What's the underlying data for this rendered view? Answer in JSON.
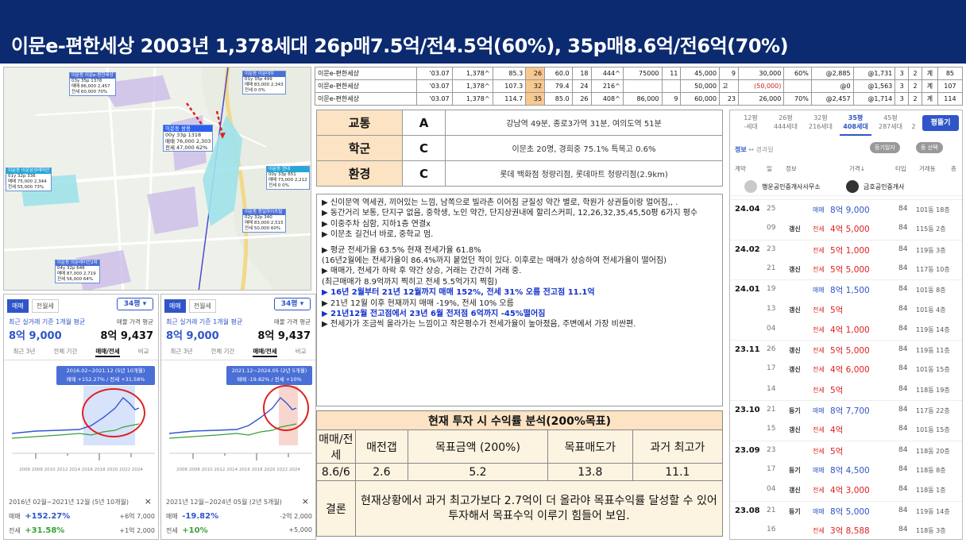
{
  "banner": {
    "title": "이문e-편한세상 2003년 1,378세대 26p매7.5억/전4.5억(60%), 35p매8.6억/전6억(70%)"
  },
  "map": {
    "labels": [
      {
        "title": "이문동 이문e-편한세상",
        "line1": "03y 35p 1378",
        "line2": "매매 86,000 2,457",
        "line3": "전세 60,000 70%"
      },
      {
        "title": "이문동 이문대우",
        "line1": "01y 35p 499",
        "line2": "매매 83,000 2,343",
        "line3": "전세 0 0%"
      },
      {
        "title": "이문동 쌍용",
        "line1": "00y 33p 1318",
        "line2": "매매 76,000 2,303",
        "line3": "전세 47,000 62%"
      },
      {
        "title": "이문동 이문삼성래미안",
        "line1": "01y 32p 336",
        "line2": "매매 75,000 2,344",
        "line3": "전세 55,000 73%"
      },
      {
        "title": "이문동 현대",
        "line1": "00y 33p 651",
        "line2": "매매 73,000 2,212",
        "line3": "전세 0 0%"
      },
      {
        "title": "이문동 동일하이츠빌",
        "line1": "02y 32p 340",
        "line2": "매매 83,000 2,515",
        "line3": "전세 50,000 60%"
      },
      {
        "title": "이문동 이문래미안2차",
        "line1": "04y 32p 646",
        "line2": "매매 87,000 2,719",
        "line3": "전세 56,000 64%"
      }
    ]
  },
  "mini_left": {
    "tab_sale": "매매",
    "tab_jeon": "전월세",
    "size": "34평 ▾",
    "label_avg": "최근 실거래 기준 1개월 평균",
    "label_ask": "매물 가격 평균",
    "value_avg": "8억 9,000",
    "value_ask": "8억 9,437",
    "period_tabs": [
      "최근 3년",
      "전체 기간",
      "매매/전세",
      "비교"
    ],
    "tooltip_line1": "2016.02~2021.12 (5년 10개월)",
    "tooltip_line2": "매매 +152.27% / 전세 +31.58%",
    "years": "2006 2008 2010 2012 2014 2016 2018 2020 2022 2024",
    "range": "2016년 02월~2021년 12월 (5년 10개월)",
    "sale_label": "매매",
    "sale_pct": "+152.27%",
    "sale_amt": "+6억 7,000",
    "jeon_label": "전세",
    "jeon_pct": "+31.58%",
    "jeon_amt": "+1억 2,000",
    "close": "×"
  },
  "mini_right": {
    "tab_sale": "매매",
    "tab_jeon": "전월세",
    "size": "34평 ▾",
    "label_avg": "최근 실거래 기준 1개월 평균",
    "label_ask": "매물 가격 평균",
    "value_avg": "8억 9,000",
    "value_ask": "8억 9,437",
    "period_tabs": [
      "최근 3년",
      "전체 기간",
      "매매/전세",
      "비교"
    ],
    "tooltip_line1": "2021.12~2024.05 (2년 5개월)",
    "tooltip_line2": "매매 -19.82% / 전세 +10%",
    "years": "2006 2008 2010 2012 2014 2016 2018 2020 2022 2024",
    "range": "2021년 12월~2024년 05월 (2년 5개월)",
    "sale_label": "매매",
    "sale_pct": "-19.82%",
    "sale_amt": "-2억 2,000",
    "jeon_label": "전세",
    "jeon_pct": "+10%",
    "jeon_amt": "+5,000",
    "close": "×"
  },
  "data_table": {
    "rows": [
      [
        "이문e-편한세상",
        "'03.07",
        "1,378^",
        "85.3",
        "26",
        "60.0",
        "18",
        "444^",
        "75000",
        "11",
        "45,000",
        "9",
        "30,000",
        "60%",
        "@2,885",
        "@1,731",
        "3",
        "2",
        "계",
        "85"
      ],
      [
        "이문e-편한세상",
        "'03.07",
        "1,378^",
        "107.3",
        "32",
        "79.4",
        "24",
        "216^",
        "",
        "",
        "50,000",
        "고",
        "(50,000)",
        "",
        "@0",
        "@1,563",
        "3",
        "2",
        "계",
        "107"
      ],
      [
        "이문e-편한세상",
        "'03.07",
        "1,378^",
        "114.7",
        "35",
        "85.0",
        "26",
        "408^",
        "86,000",
        "9",
        "60,000",
        "23",
        "26,000",
        "70%",
        "@2,457",
        "@1,714",
        "3",
        "2",
        "계",
        "114"
      ]
    ]
  },
  "rating": {
    "rows": [
      {
        "cat": "교통",
        "grade": "A",
        "desc": "강남역 49분, 종로3가역 31분, 여의도역 51분"
      },
      {
        "cat": "학군",
        "grade": "C",
        "desc": "이문초 20명, 경희중 75.1%  특목고 0.6%"
      },
      {
        "cat": "환경",
        "grade": "C",
        "desc": "롯데 백화점 청량리점, 롯데마트 청량리점(2.9km)"
      }
    ]
  },
  "notes": {
    "lines": [
      "▶ 신이문역 역세권, 끼어있는 느낌, 남쪽으로 빌라촌 이어짐 균질성 약간 별로, 학원가 상권들이랑 멀어짐,, .",
      "▶ 동간거리 보통, 단지구 없음, 중학생, 노인 약간, 단지상권내에 할리스커피, 12,26,32,35,45,50평 6가지 평수",
      "▶ 이중주차 심함, 지하1층 연결x",
      "▶ 이문초 길건너 바로, 중학교 멈.",
      "▶ 평균 전세가율 63.5% 현재 전세가율 61.8%",
      "(16년2월에는 전세가율이 86.4%까지 붙었던 적이 있다. 이후로는 매매가 상승하여 전세가율이 떨어짐)",
      "▶ 매매가, 전세가 하락 후 약간 상승, 거래는 간간히 거래 중.",
      "(최근매매가 8.9억까지 찍히고 전세 5.5억가지 찍힘)",
      "▶ 16년 2월부터 21년 12월까지 매매 152%, 전세 31% 오름 전고점 11.1억",
      "▶ 21년 12월 이후 현재까지 매매 -19%, 전세 10% 오름",
      "▶ 21년12월 전고점에서 23년 6월 전저점 6억까지 -45%떨어짐",
      "▶ 전세가가 조금씩 올라가는 느낌이고 작은평수가 전세가율이 높아졌음, 주변에서 가장 비싼편."
    ]
  },
  "analysis": {
    "title": "현재 투자 시 수익률 분석(200%목표)",
    "headers": [
      "매매/전세",
      "매전갭",
      "목표금액 (200%)",
      "목표매도가",
      "과거 최고가"
    ],
    "values": [
      "8.6/6",
      "2.6",
      "5.2",
      "13.8",
      "11.1"
    ],
    "conclusion_label": "결론",
    "conclusion": "현재상황에서 과거 최고가보다 2.7억이 더 올라야 목표수익률 달성할 수 있어 투자해서 목표수익 이루기 힘들어 보임."
  },
  "rpanel": {
    "size_tabs": [
      {
        "p": "12평",
        "h": "-세대"
      },
      {
        "p": "26평",
        "h": "444세대"
      },
      {
        "p": "32평",
        "h": "216세대"
      },
      {
        "p": "35평",
        "h": "408세대"
      },
      {
        "p": "45평",
        "h": "287세대"
      }
    ],
    "more": "2",
    "pyeong_button": "평뜰기",
    "info_tab": "정보",
    "arrow": "↔",
    "history_tab": "경과일",
    "pill1": "등기일자",
    "pill2": "동 선택",
    "col_heads": [
      "계약",
      "일",
      "정보",
      "가격↓",
      "타입",
      "거래동",
      "층"
    ],
    "agent1": "행운공인중개사사무소",
    "agent2": "금호공인중개사",
    "rows": [
      {
        "ym": "24.04",
        "day": "25",
        "kind": "",
        "type": "매매",
        "price": "8억 9,000",
        "area": "84",
        "floor": "101동 18층",
        "cls": "sale"
      },
      {
        "ym": "",
        "day": "09",
        "kind": "갱신",
        "type": "전세",
        "price": "4억 5,000",
        "area": "84",
        "floor": "115동 2층",
        "cls": "jeon"
      },
      {
        "ym": "24.02",
        "day": "23",
        "kind": "",
        "type": "전세",
        "price": "5억 1,000",
        "area": "84",
        "floor": "119동 3층",
        "cls": "jeon"
      },
      {
        "ym": "",
        "day": "21",
        "kind": "갱신",
        "type": "전세",
        "price": "5억 5,000",
        "area": "84",
        "floor": "117동 10층",
        "cls": "jeon"
      },
      {
        "ym": "24.01",
        "day": "19",
        "kind": "",
        "type": "매매",
        "price": "8억 1,500",
        "area": "84",
        "floor": "101동 8층",
        "cls": "sale"
      },
      {
        "ym": "",
        "day": "13",
        "kind": "갱신",
        "type": "전세",
        "price": "5억",
        "area": "84",
        "floor": "101동 4층",
        "cls": "jeon"
      },
      {
        "ym": "",
        "day": "04",
        "kind": "",
        "type": "전세",
        "price": "4억 1,000",
        "area": "84",
        "floor": "119동 14층",
        "cls": "jeon"
      },
      {
        "ym": "23.11",
        "day": "26",
        "kind": "갱신",
        "type": "전세",
        "price": "5억 5,000",
        "area": "84",
        "floor": "119동 11층",
        "cls": "jeon"
      },
      {
        "ym": "",
        "day": "17",
        "kind": "갱신",
        "type": "전세",
        "price": "4억 6,000",
        "area": "84",
        "floor": "101동 15층",
        "cls": "jeon"
      },
      {
        "ym": "",
        "day": "14",
        "kind": "",
        "type": "전세",
        "price": "5억",
        "area": "84",
        "floor": "118동 19층",
        "cls": "jeon"
      },
      {
        "ym": "23.10",
        "day": "21",
        "kind": "등기",
        "type": "매매",
        "price": "8억 7,700",
        "area": "84",
        "floor": "117동 22층",
        "cls": "sale"
      },
      {
        "ym": "",
        "day": "15",
        "kind": "갱신",
        "type": "전세",
        "price": "4억",
        "area": "84",
        "floor": "101동 15층",
        "cls": "jeon"
      },
      {
        "ym": "23.09",
        "day": "23",
        "kind": "",
        "type": "전세",
        "price": "5억",
        "area": "84",
        "floor": "118동 20층",
        "cls": "jeon"
      },
      {
        "ym": "",
        "day": "17",
        "kind": "등기",
        "type": "매매",
        "price": "8억 4,500",
        "area": "84",
        "floor": "118동 8층",
        "cls": "sale"
      },
      {
        "ym": "",
        "day": "04",
        "kind": "갱신",
        "type": "전세",
        "price": "4억 3,000",
        "area": "84",
        "floor": "118동 1층",
        "cls": "jeon"
      },
      {
        "ym": "23.08",
        "day": "21",
        "kind": "등기",
        "type": "매매",
        "price": "8억 5,000",
        "area": "84",
        "floor": "119동 14층",
        "cls": "sale"
      },
      {
        "ym": "",
        "day": "16",
        "kind": "",
        "type": "전세",
        "price": "3억 8,588",
        "area": "84",
        "floor": "118동 3층",
        "cls": "jeon"
      }
    ]
  },
  "colors": {
    "banner": "#0b2a6f",
    "sale": "#2f55c8",
    "jeon": "#e02020",
    "accent_orange": "#fbe3c3"
  }
}
